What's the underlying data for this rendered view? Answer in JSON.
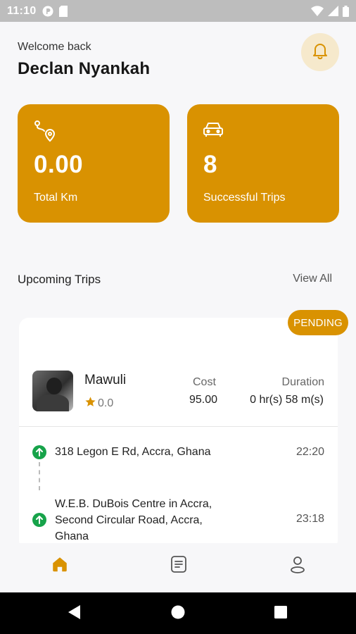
{
  "status_bar": {
    "time": "11:10"
  },
  "header": {
    "welcome": "Welcome back",
    "user_name": "Declan Nyankah"
  },
  "stats": [
    {
      "icon": "route-icon",
      "value": "0.00",
      "label": "Total Km"
    },
    {
      "icon": "car-icon",
      "value": "8",
      "label": "Successful Trips"
    }
  ],
  "upcoming": {
    "title": "Upcoming Trips",
    "view_all": "View All"
  },
  "trip": {
    "status": "PENDING",
    "driver_name": "Mawuli",
    "rating": "0.0",
    "cost_label": "Cost",
    "cost": "95.00",
    "duration_label": "Duration",
    "duration": "0 hr(s) 58 m(s)",
    "stops": [
      {
        "address": "318 Legon E Rd, Accra, Ghana",
        "time": "22:20"
      },
      {
        "address": "W.E.B. DuBois Centre in Accra, Second Circular Road, Accra, Ghana",
        "time": "23:18"
      }
    ]
  },
  "bottom_nav": [
    {
      "name": "home-icon",
      "active": true
    },
    {
      "name": "trips-list-icon",
      "active": false
    },
    {
      "name": "profile-icon",
      "active": false
    }
  ],
  "colors": {
    "accent": "#d99201",
    "accent_light": "#f6e9cc",
    "success": "#17a34a",
    "background": "#f7f7f9"
  }
}
